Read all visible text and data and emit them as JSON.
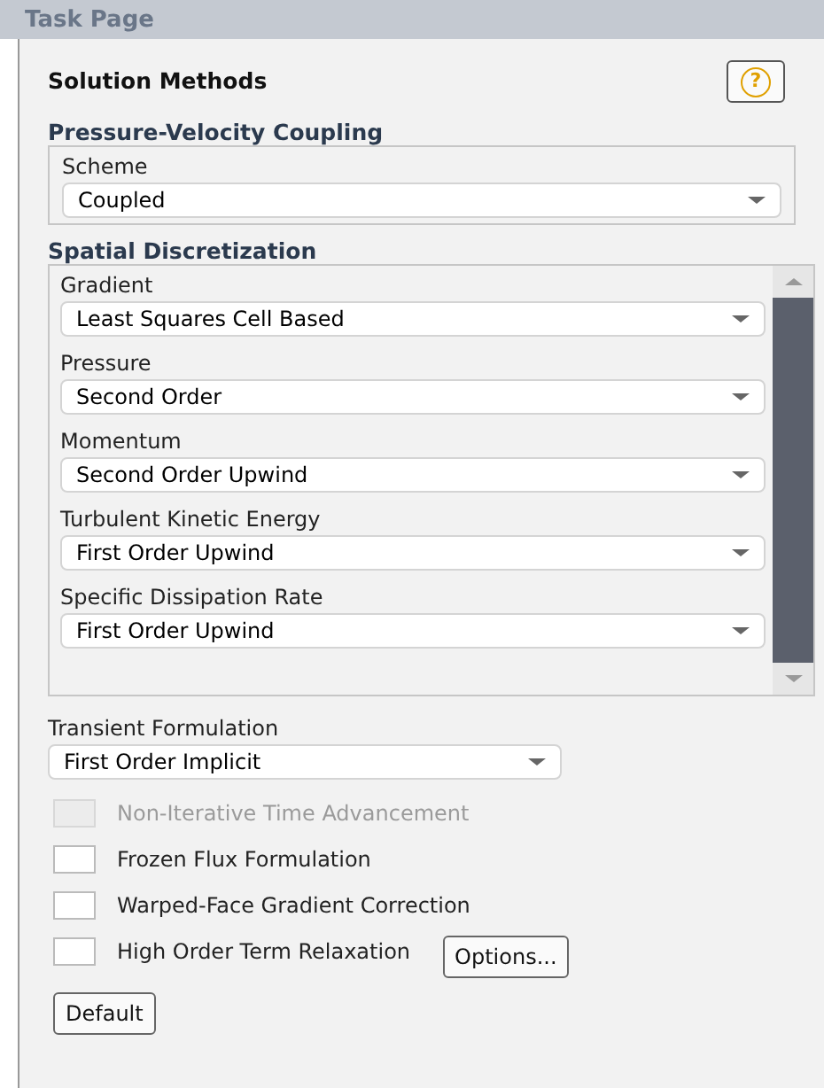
{
  "window": {
    "title": "Task Page"
  },
  "panel": {
    "title": "Solution Methods",
    "help_button": "?"
  },
  "pressure_velocity": {
    "heading": "Pressure-Velocity Coupling",
    "fields": [
      {
        "label": "Scheme",
        "value": "Coupled"
      }
    ]
  },
  "spatial": {
    "heading": "Spatial Discretization",
    "fields": [
      {
        "label": "Gradient",
        "value": "Least Squares Cell Based"
      },
      {
        "label": "Pressure",
        "value": "Second Order"
      },
      {
        "label": "Momentum",
        "value": "Second Order Upwind"
      },
      {
        "label": "Turbulent Kinetic Energy",
        "value": "First Order Upwind"
      },
      {
        "label": "Specific Dissipation Rate",
        "value": "First Order Upwind"
      }
    ]
  },
  "transient": {
    "label": "Transient Formulation",
    "value": "First Order Implicit"
  },
  "options": [
    {
      "label": "Non-Iterative Time Advancement",
      "checked": false,
      "disabled": true
    },
    {
      "label": "Frozen Flux Formulation",
      "checked": false,
      "disabled": false
    },
    {
      "label": "Warped-Face Gradient Correction",
      "checked": false,
      "disabled": false
    },
    {
      "label": "High Order Term Relaxation",
      "checked": false,
      "disabled": false,
      "button": "Options..."
    }
  ],
  "buttons": [
    "Default"
  ]
}
